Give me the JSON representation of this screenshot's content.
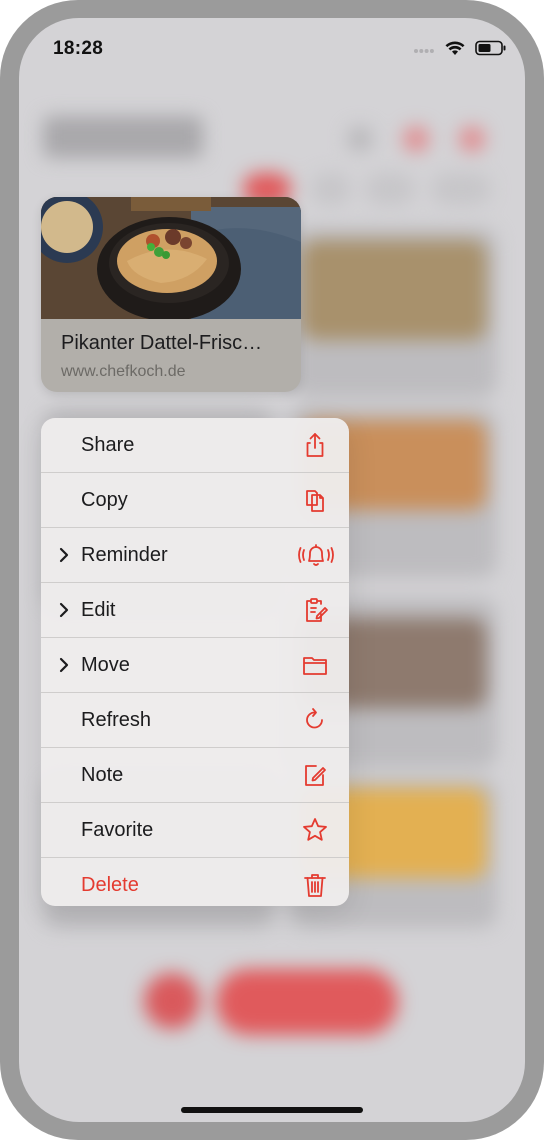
{
  "status_bar": {
    "time": "18:28"
  },
  "preview": {
    "title": "Pikanter Dattel-Frisc…",
    "source": "www.chefkoch.de"
  },
  "menu": {
    "items": [
      {
        "label": "Share",
        "icon": "share-icon",
        "submenu": false
      },
      {
        "label": "Copy",
        "icon": "copy-icon",
        "submenu": false
      },
      {
        "label": "Reminder",
        "icon": "bell-ringing-icon",
        "submenu": true
      },
      {
        "label": "Edit",
        "icon": "clipboard-edit-icon",
        "submenu": true
      },
      {
        "label": "Move",
        "icon": "folder-icon",
        "submenu": true
      },
      {
        "label": "Refresh",
        "icon": "refresh-icon",
        "submenu": false
      },
      {
        "label": "Note",
        "icon": "note-edit-icon",
        "submenu": false
      },
      {
        "label": "Favorite",
        "icon": "star-icon",
        "submenu": false
      },
      {
        "label": "Delete",
        "icon": "trash-icon",
        "submenu": false,
        "destructive": true
      }
    ]
  },
  "colors": {
    "accent": "#e43b30",
    "menu_background": "#eeecec",
    "text": "#1c1c1e"
  }
}
